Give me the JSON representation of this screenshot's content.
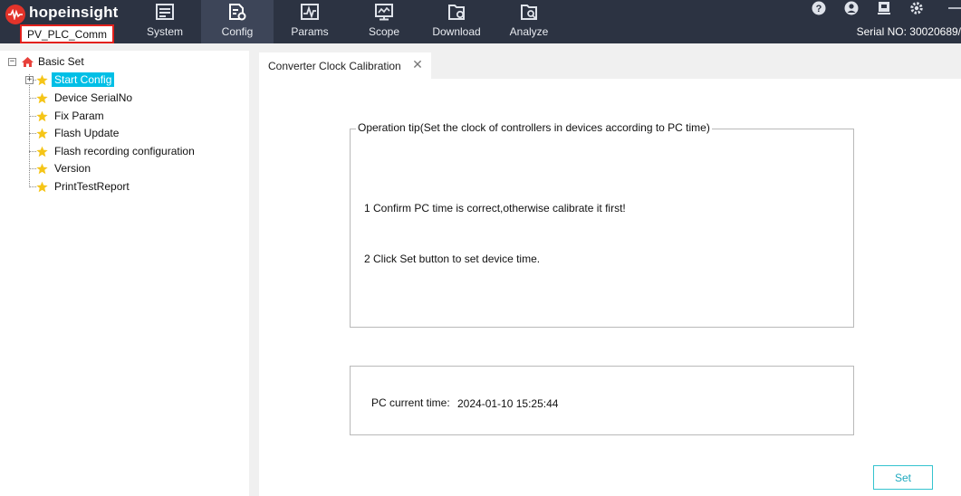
{
  "app": {
    "brand": "hopeinsight",
    "project_name": "PV_PLC_Comm",
    "serial_text": "Serial NO: 30020689/"
  },
  "toolbar": [
    {
      "label": "System",
      "icon": "system-icon"
    },
    {
      "label": "Config",
      "icon": "config-icon",
      "active": true
    },
    {
      "label": "Params",
      "icon": "params-icon"
    },
    {
      "label": "Scope",
      "icon": "scope-icon"
    },
    {
      "label": "Download",
      "icon": "download-icon"
    },
    {
      "label": "Analyze",
      "icon": "analyze-icon"
    }
  ],
  "header_icons": [
    "help-icon",
    "user-icon",
    "device-icon",
    "settings-icon",
    "minimize-icon"
  ],
  "tree": {
    "root": {
      "label": "Basic Set",
      "icon": "home-icon"
    },
    "items": [
      {
        "label": "Start Config",
        "selected": true,
        "expandable": true
      },
      {
        "label": "Device SerialNo"
      },
      {
        "label": "Fix Param"
      },
      {
        "label": "Flash Update"
      },
      {
        "label": "Flash recording configuration"
      },
      {
        "label": "Version"
      },
      {
        "label": "PrintTestReport"
      }
    ]
  },
  "tab": {
    "title": "Converter Clock Calibration",
    "close_symbol": "✕"
  },
  "tips": {
    "legend": "Operation tip(Set the clock of controllers in devices according to PC time)",
    "lines": [
      "1  Confirm PC time is correct,otherwise calibrate it first!",
      "2  Click Set button to set device time."
    ]
  },
  "pc_time": {
    "label": "PC current time:",
    "value": "2024-01-10 15:25:44"
  },
  "buttons": {
    "set": "Set"
  },
  "colors": {
    "toolbar_bg": "#2c3342",
    "selected_bg": "#00bfe6",
    "highlight_border": "#e3201b",
    "button_border": "#34c3cf"
  }
}
